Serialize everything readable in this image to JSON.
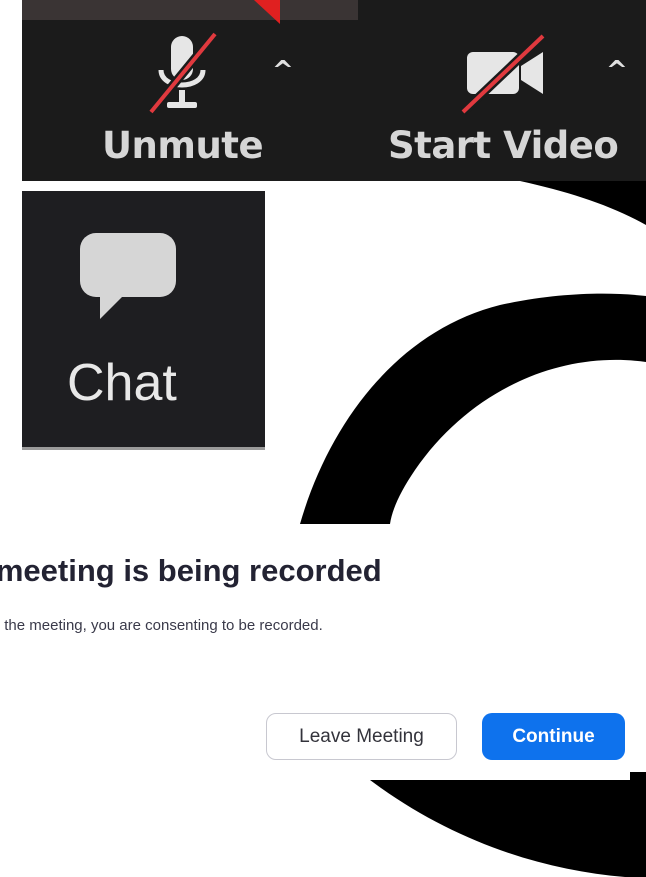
{
  "toolbar": {
    "unmute_label": "Unmute",
    "unmute_icon": "microphone-muted-icon",
    "start_video_label": "Start Video",
    "start_video_icon": "camera-off-icon",
    "caret_glyph": "^"
  },
  "chat": {
    "label": "Chat",
    "icon": "chat-bubble-icon"
  },
  "recording_dialog": {
    "title": "s meeting is being recorded",
    "message": "nuing to be in the meeting, you are consenting to be recorded.",
    "leave_button": "Leave Meeting",
    "continue_button": "Continue"
  },
  "colors": {
    "toolbar_bg": "#1b1b1b",
    "muted_slash": "#e0393e",
    "continue_blue": "#0e72ed",
    "decoration": "#000000"
  }
}
